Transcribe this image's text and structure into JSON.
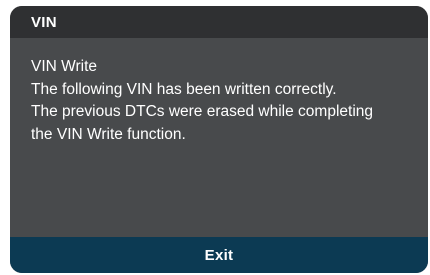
{
  "dialog": {
    "title": "VIN",
    "lines": [
      "VIN Write",
      "The following VIN has been written correctly.",
      "The previous DTCs were erased while completing",
      "the VIN Write function."
    ],
    "exit_label": "Exit"
  },
  "colors": {
    "body": "#484a4c",
    "titlebar": "#2f3032",
    "exit_bar": "#0c3a53",
    "text": "#ffffff"
  }
}
